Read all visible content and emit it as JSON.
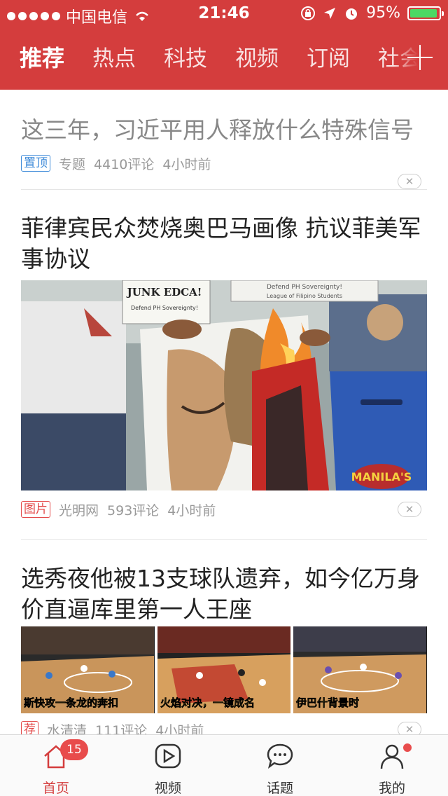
{
  "status_bar": {
    "carrier": "中国电信",
    "time": "21:46",
    "battery": "95%",
    "battery_level": 0.95
  },
  "nav_tabs": [
    {
      "label": "推荐",
      "active": true
    },
    {
      "label": "热点"
    },
    {
      "label": "科技"
    },
    {
      "label": "视频"
    },
    {
      "label": "订阅"
    },
    {
      "label": "社会"
    }
  ],
  "feed": [
    {
      "title": "这三年，习近平用人释放什么特殊信号",
      "tag": "置顶",
      "source": "专题",
      "comments": "4410评论",
      "time": "4小时前"
    },
    {
      "title": "菲律宾民众焚烧奥巴马画像 抗议菲美军事协议",
      "tag": "图片",
      "source": "光明网",
      "comments": "593评论",
      "time": "4小时前",
      "image_text": {
        "sign_left": "JUNK EDCA!",
        "sign_left_sub": "Defend PH Sovereignty!",
        "sign_right": "Defend PH Sovereignty!",
        "sign_right_sub": "League of Filipino Students",
        "shield": "MANILA'S"
      }
    },
    {
      "title": "选秀夜他被13支球队遗弃，如今亿万身价直逼库里第一人王座",
      "tag": "荐",
      "source": "水清清",
      "comments": "111评论",
      "time": "4小时前",
      "thumb_captions": [
        "斯快攻一条龙的奔扣",
        "火焰对决，一镜成名",
        "伊巴什背景时"
      ]
    }
  ],
  "bottom_bar": [
    {
      "label": "首页",
      "badge": "15",
      "active": true,
      "icon": "home-icon"
    },
    {
      "label": "视频",
      "icon": "play-icon"
    },
    {
      "label": "话题",
      "icon": "chat-bubble-icon"
    },
    {
      "label": "我的",
      "icon": "person-icon",
      "dot": true
    }
  ]
}
